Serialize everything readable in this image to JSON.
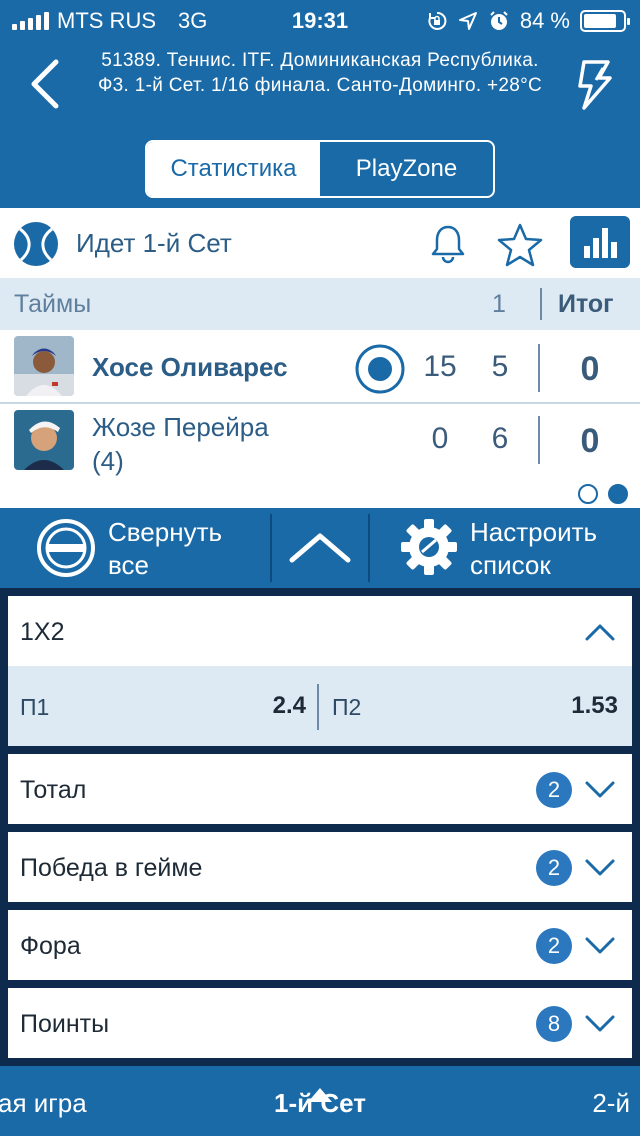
{
  "status_bar": {
    "carrier": "MTS RUS",
    "network": "3G",
    "time": "19:31",
    "battery": "84 %",
    "battery_level": 0.84,
    "icons": [
      "signal-bars-icon",
      "rotation-lock-icon",
      "location-arrow-icon",
      "alarm-clock-icon",
      "battery-icon"
    ]
  },
  "header": {
    "title": "51389. Теннис. ITF. Доминиканская Республика. Ф3. 1-й  Сет. 1/16 финала. Санто-Доминго. +28°C",
    "back_icon": "chevron-left-icon",
    "right_icon": "lightning-icon",
    "segments": [
      "Статистика",
      "PlayZone"
    ],
    "active_segment": "Статистика"
  },
  "match": {
    "sport_icon": "tennis-ball-icon",
    "status": "Идет 1-й  Сет",
    "icons": [
      "bell-icon",
      "star-icon",
      "bar-chart-icon"
    ],
    "columns": {
      "periods_label": "Таймы",
      "set1": "1",
      "total": "Итог"
    },
    "players": [
      {
        "name": "Хосе Оливарес",
        "serving": true,
        "points": "15",
        "games": "5",
        "total": "0"
      },
      {
        "name": "Жозе Перейра",
        "seed": "(4)",
        "serving": false,
        "points": "0",
        "games": "6",
        "total": "0"
      }
    ],
    "pager": {
      "pages": 2,
      "current": 2
    }
  },
  "actions": {
    "collapse_label": "Свернуть все",
    "collapse_line1": "Свернуть",
    "collapse_line2": "все",
    "settings_line1": "Настроить",
    "settings_line2": "список"
  },
  "markets": [
    {
      "title": "1X2",
      "expanded": true,
      "outcomes": [
        {
          "label": "П1",
          "value": "2.4"
        },
        {
          "label": "П2",
          "value": "1.53"
        }
      ]
    },
    {
      "title": "Тотал",
      "count": "2"
    },
    {
      "title": "Победа в гейме",
      "count": "2"
    },
    {
      "title": "Фора",
      "count": "2"
    },
    {
      "title": "Поинты",
      "count": "8"
    }
  ],
  "bottom_tabs": {
    "prev": "ая игра",
    "current": "1-й  Сет",
    "next": "2-й"
  },
  "colors": {
    "primary": "#1a6aa8",
    "dark_bg": "#0e2a4d",
    "light_row": "#dde9f3",
    "text_blue": "#2c5d86",
    "badge": "#2b78bf"
  }
}
